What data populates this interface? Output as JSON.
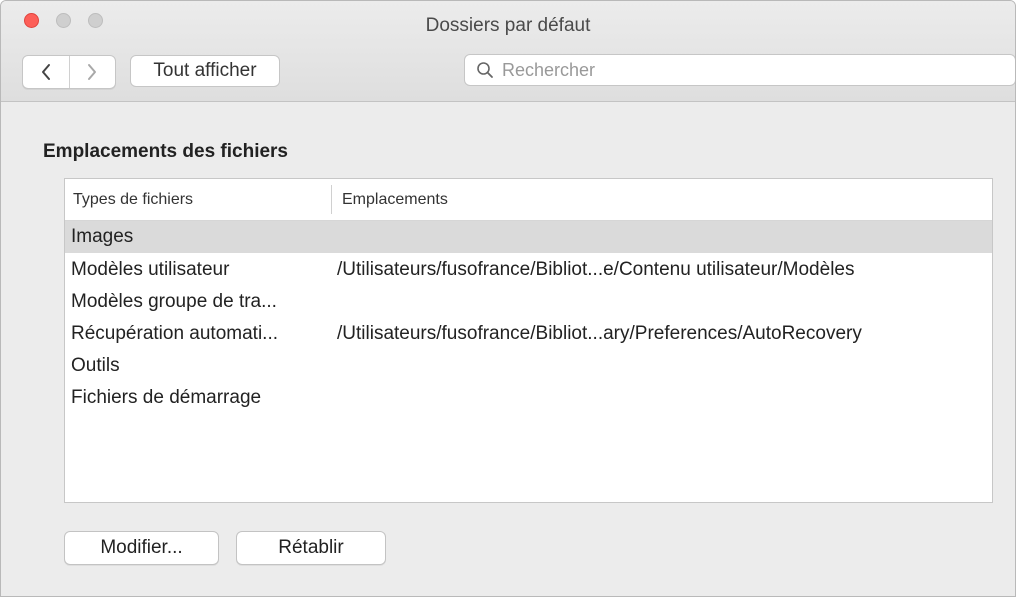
{
  "window": {
    "title": "Dossiers par défaut",
    "traffic_colors": {
      "close": "#fd5f58",
      "inactive": "#cfcfcf"
    }
  },
  "toolbar": {
    "back_icon": "chevron-left-icon",
    "forward_icon": "chevron-right-icon",
    "show_all_label": "Tout afficher",
    "search_placeholder": "Rechercher"
  },
  "main": {
    "section_title": "Emplacements des fichiers",
    "table": {
      "headers": [
        "Types de fichiers",
        "Emplacements"
      ],
      "rows": [
        {
          "type": "Images",
          "location": "",
          "selected": true
        },
        {
          "type": "Modèles utilisateur",
          "location": "/Utilisateurs/fusofrance/Bibliot...e/Contenu utilisateur/Modèles"
        },
        {
          "type": "Modèles groupe de tra...",
          "location": ""
        },
        {
          "type": "Récupération automati...",
          "location": "/Utilisateurs/fusofrance/Bibliot...ary/Preferences/AutoRecovery"
        },
        {
          "type": "Outils",
          "location": ""
        },
        {
          "type": "Fichiers de démarrage",
          "location": ""
        }
      ]
    },
    "buttons": {
      "modify": "Modifier...",
      "reset": "Rétablir"
    }
  }
}
